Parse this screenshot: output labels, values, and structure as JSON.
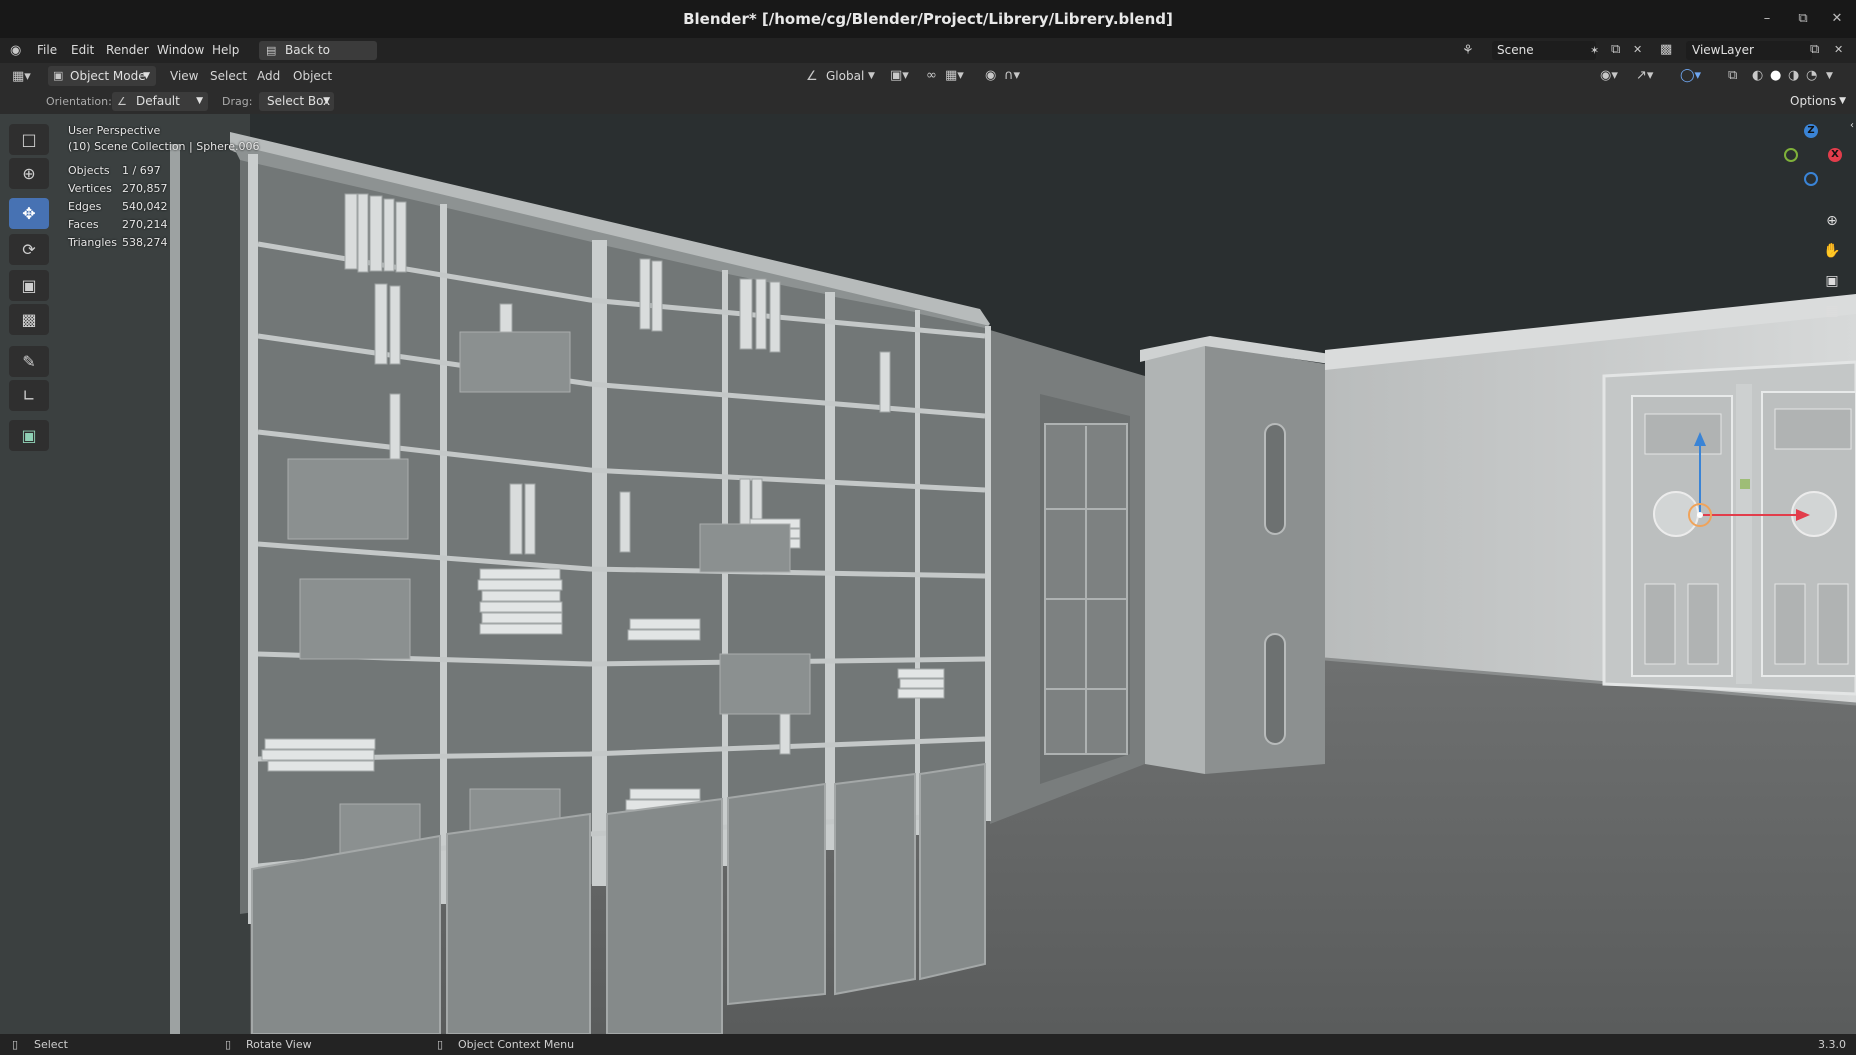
{
  "window": {
    "title": "Blender* [/home/cg/Blender/Project/Librery/Librery.blend]"
  },
  "menu": {
    "items": [
      "File",
      "Edit",
      "Render",
      "Window",
      "Help"
    ],
    "back_button": "Back to Previous",
    "scene": "Scene",
    "view_layer": "ViewLayer"
  },
  "header": {
    "mode": "Object Mode",
    "menus": [
      "View",
      "Select",
      "Add",
      "Object"
    ],
    "transform_orientation": "Global"
  },
  "tool_header": {
    "orientation_label": "Orientation:",
    "orientation_value": "Default",
    "drag_label": "Drag:",
    "drag_value": "Select Box",
    "options_label": "Options"
  },
  "overlay": {
    "view_name": "User Perspective",
    "collection": "(10) Scene Collection | Sphere.006",
    "stats": [
      {
        "label": "Objects",
        "value": "1 / 697"
      },
      {
        "label": "Vertices",
        "value": "270,857"
      },
      {
        "label": "Edges",
        "value": "540,042"
      },
      {
        "label": "Faces",
        "value": "270,214"
      },
      {
        "label": "Triangles",
        "value": "538,274"
      }
    ]
  },
  "gizmo": {
    "z": "Z",
    "x": "X"
  },
  "toolbar": {
    "tools": [
      "select-box",
      "cursor",
      "move",
      "rotate",
      "scale",
      "transform",
      "annotate",
      "measure",
      "add-cube"
    ],
    "active": "move"
  },
  "status": {
    "select": "Select",
    "rotate": "Rotate View",
    "context": "Object Context Menu",
    "version": "3.3.0"
  },
  "colors": {
    "accent": "#4772b3",
    "axis_x": "#e23d4b",
    "axis_y": "#7fb13a",
    "axis_z": "#3a84d6"
  }
}
